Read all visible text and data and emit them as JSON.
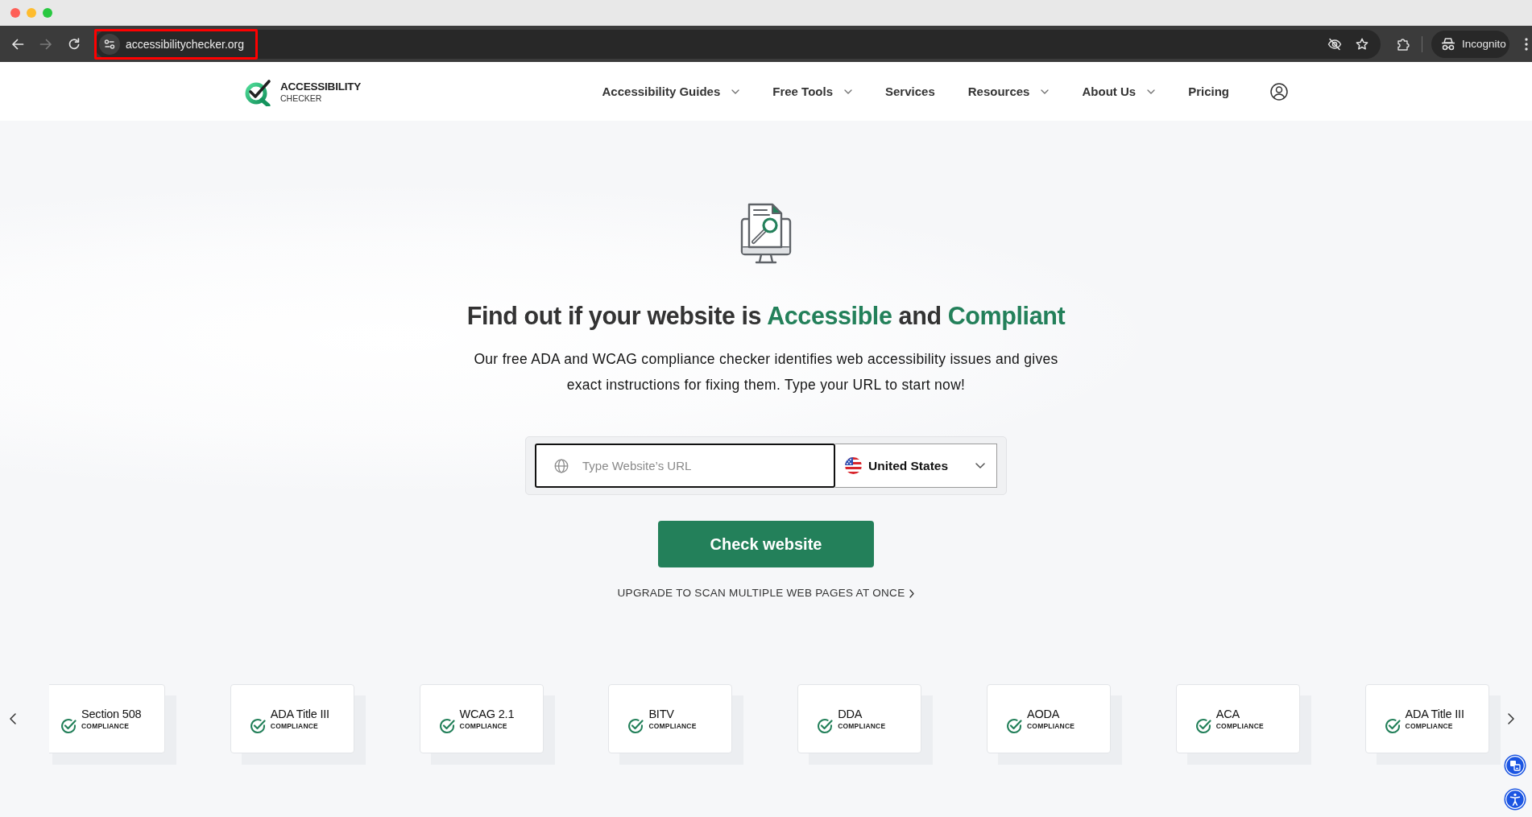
{
  "browser": {
    "nav_buttons": [
      {
        "kind": "back",
        "disabled": false
      },
      {
        "kind": "forward",
        "disabled": true
      },
      {
        "kind": "reload",
        "disabled": false
      }
    ],
    "url": "accessibilitychecker.org",
    "url_highlighted": true,
    "profile": "Incognito"
  },
  "site_header": {
    "logo": {
      "title": "ACCESSIBILITY",
      "subtitle": "CHECKER"
    },
    "nav": [
      {
        "label": "Accessibility Guides",
        "dropdown": true
      },
      {
        "label": "Free Tools",
        "dropdown": true
      },
      {
        "label": "Services",
        "dropdown": false
      },
      {
        "label": "Resources",
        "dropdown": true
      },
      {
        "label": "About Us",
        "dropdown": true
      },
      {
        "label": "Pricing",
        "dropdown": false
      }
    ]
  },
  "hero": {
    "heading": [
      {
        "text": "Find out if your website is",
        "highlight": false
      },
      {
        "text": "Accessible",
        "highlight": true
      },
      {
        "text": "and",
        "highlight": false
      },
      {
        "text": "Compliant",
        "highlight": true
      }
    ],
    "description": "Our free ADA and WCAG compliance checker identifies web accessibility issues and gives exact instructions for fixing them. Type your URL to start now!",
    "url_field": {
      "placeholder": "Type Website’s URL"
    },
    "country_select": {
      "value": "United States"
    },
    "submit_button": "Check website",
    "upgrade_link": "UPGRADE TO SCAN MULTIPLE WEB PAGES AT ONCE"
  },
  "compliance_carousel": {
    "cards": [
      {
        "title": "Section 508",
        "subtitle": "COMPLIANCE"
      },
      {
        "title": "ADA Title III",
        "subtitle": "COMPLIANCE"
      },
      {
        "title": "WCAG 2.1",
        "subtitle": "COMPLIANCE"
      },
      {
        "title": "BITV",
        "subtitle": "COMPLIANCE"
      },
      {
        "title": "DDA",
        "subtitle": "COMPLIANCE"
      },
      {
        "title": "AODA",
        "subtitle": "COMPLIANCE"
      },
      {
        "title": "ACA",
        "subtitle": "COMPLIANCE"
      },
      {
        "title": "ADA Title III",
        "subtitle": "COMPLIANCE"
      }
    ]
  }
}
